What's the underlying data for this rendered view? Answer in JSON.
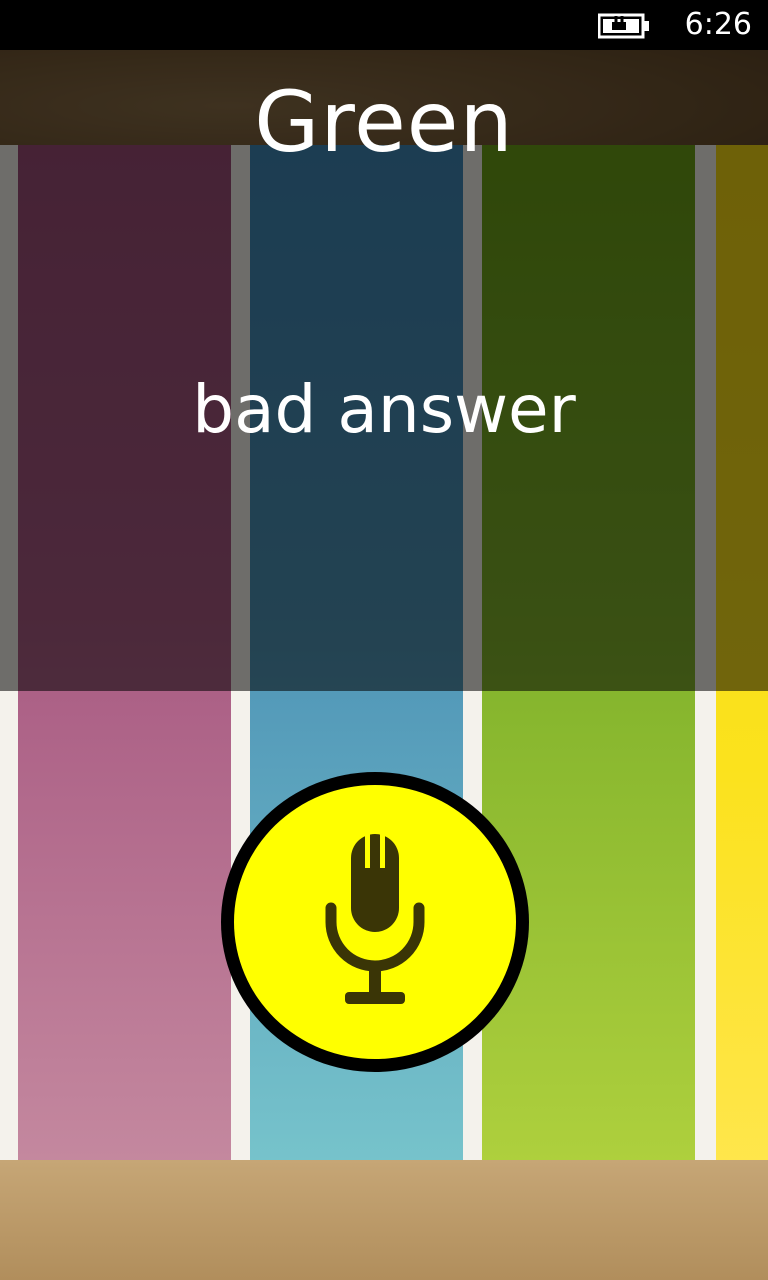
{
  "status_bar": {
    "time": "6:26",
    "battery_icon": "battery-charging-icon"
  },
  "main": {
    "title": "Green",
    "feedback": "bad answer",
    "mic_icon": "microphone-icon"
  },
  "colors": {
    "stripe_pink": "#b3587c",
    "stripe_blue": "#4b98bf",
    "stripe_green": "#8fba2a",
    "stripe_yellow": "#ffe61c",
    "mic_button_fill": "#ffff00",
    "mic_icon_color": "#3a3506"
  }
}
